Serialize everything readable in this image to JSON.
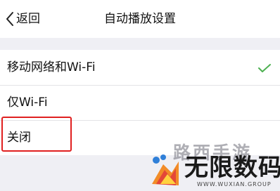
{
  "header": {
    "back_label": "返回",
    "title": "自动播放设置"
  },
  "options": [
    {
      "label": "移动网络和Wi-Fi",
      "selected": true
    },
    {
      "label": "仅Wi-Fi",
      "selected": false
    },
    {
      "label": "关闭",
      "selected": false
    }
  ],
  "watermark": {
    "top_text": "路西手游",
    "main_text": "无限数码",
    "url": "WWW.WUXIAN.GROUP"
  },
  "colors": {
    "check": "#4cb050",
    "highlight": "#e02020"
  }
}
